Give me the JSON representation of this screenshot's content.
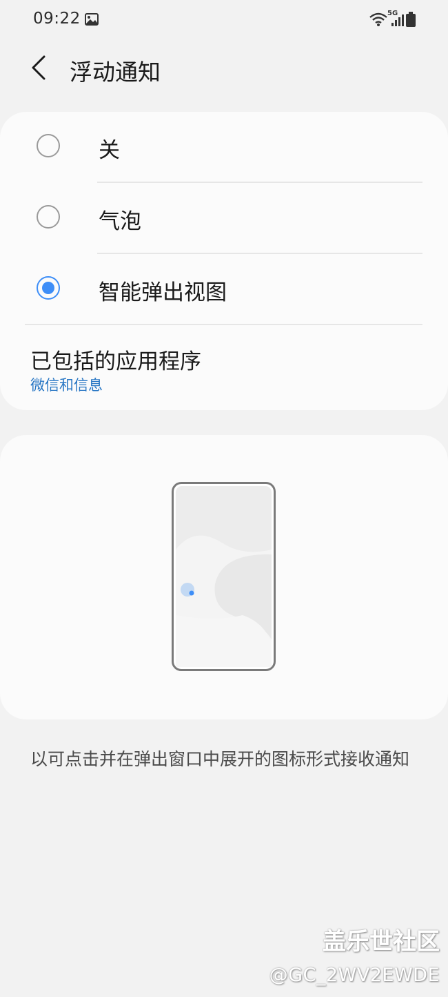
{
  "status_bar": {
    "time": "09:22",
    "network_label": "5G",
    "icons": [
      "gallery-icon",
      "wifi-icon",
      "signal-icon",
      "battery-icon"
    ]
  },
  "header": {
    "back_icon": "chevron-left-icon",
    "title": "浮动通知"
  },
  "options": [
    {
      "label": "关",
      "selected": false
    },
    {
      "label": "气泡",
      "selected": false
    },
    {
      "label": "智能弹出视图",
      "selected": true
    }
  ],
  "included_apps": {
    "title": "已包括的应用程序",
    "subtitle": "微信和信息"
  },
  "description": "以可点击并在弹出窗口中展开的图标形式接收通知",
  "watermark": {
    "title": "盖乐世社区",
    "user": "@GC_2WV2EWDE"
  },
  "colors": {
    "accent": "#3e8ef7",
    "link": "#2776c4",
    "background": "#f2f2f2",
    "card": "#fbfbfb"
  }
}
